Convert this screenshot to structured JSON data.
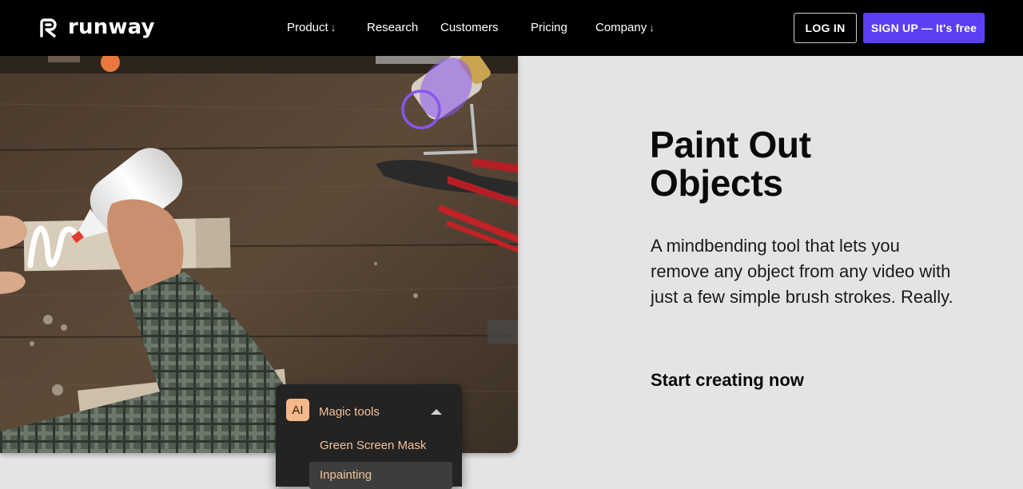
{
  "brand": {
    "name": "runway",
    "logo_icon": "runway-logo-icon"
  },
  "nav": {
    "items": [
      {
        "label": "Product",
        "has_dropdown": true
      },
      {
        "label": "Research",
        "has_dropdown": false
      },
      {
        "label": "Customers",
        "has_dropdown": false
      },
      {
        "label": "Pricing",
        "has_dropdown": false
      },
      {
        "label": "Company",
        "has_dropdown": true
      }
    ],
    "dropdown_glyph": "↓",
    "login_label": "LOG IN",
    "signup_label": "SIGN UP — It's free"
  },
  "hero": {
    "title": "Paint Out Objects",
    "description": "A mindbending tool that lets you remove any object from any video with just a few simple brush strokes. Really.",
    "cta": "Start creating now"
  },
  "tools_panel": {
    "badge": "AI",
    "title": "Magic tools",
    "items": [
      {
        "label": "Green Screen Mask",
        "active": false
      },
      {
        "label": "Inpainting",
        "active": true
      }
    ]
  },
  "colors": {
    "nav_bg": "#000000",
    "page_bg": "#e4e4e4",
    "accent": "#5a3ff5",
    "tool_text": "#f5c29a",
    "brush": "#8a55f0"
  }
}
